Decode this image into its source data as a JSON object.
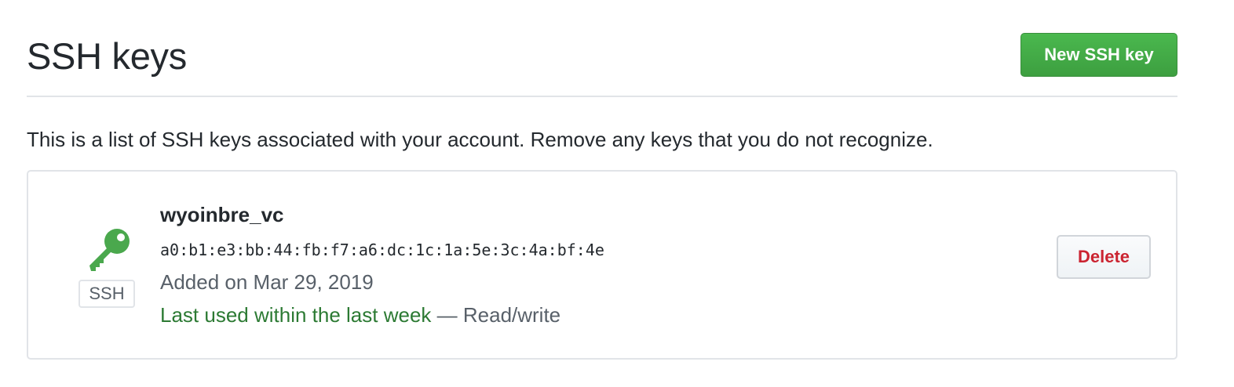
{
  "header": {
    "title": "SSH keys",
    "new_key_label": "New SSH key"
  },
  "description": "This is a list of SSH keys associated with your account. Remove any keys that you do not recognize.",
  "keys": [
    {
      "title": "wyoinbre_vc",
      "fingerprint": "a0:b1:e3:bb:44:fb:f7:a6:dc:1c:1a:5e:3c:4a:bf:4e",
      "added": "Added on Mar 29, 2019",
      "last_used": "Last used within the last week",
      "access": " — Read/write",
      "badge": "SSH",
      "icon": "key-icon",
      "delete_label": "Delete"
    }
  ],
  "colors": {
    "primary_button": "#3d9f40",
    "key_icon": "#4aa84d",
    "last_used_text": "#2c7a33",
    "delete_text": "#cb2431"
  }
}
